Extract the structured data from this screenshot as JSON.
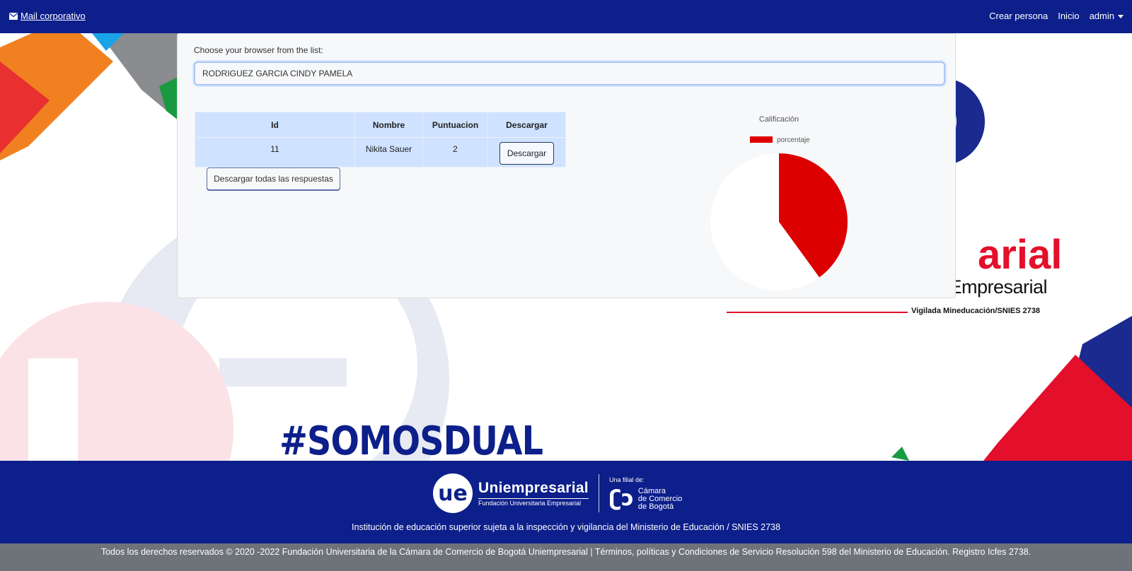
{
  "navbar": {
    "mail_label": "Mail corporativo",
    "crear_persona": "Crear persona",
    "inicio": "Inicio",
    "admin": "admin"
  },
  "form": {
    "label": "Choose your browser from the list:",
    "selected_value": "RODRIGUEZ GARCIA CINDY PAMELA"
  },
  "table": {
    "headers": [
      "Id",
      "Nombre",
      "Puntuacion",
      "Descargar"
    ],
    "rows": [
      {
        "id": "11",
        "nombre": "Nikita Sauer",
        "puntuacion": "2",
        "action": "Descargar"
      }
    ]
  },
  "download_all_label": "Descargar todas las respuestas",
  "chart_data": {
    "type": "pie",
    "title": "Calificación",
    "legend": [
      "porcentaje"
    ],
    "legend_position": "top",
    "slices": [
      {
        "label": "porcentaje",
        "value": 40,
        "color": "#dd0000"
      },
      {
        "label": "",
        "value": 60,
        "color": "#ffffff"
      }
    ]
  },
  "background": {
    "hashtag": "#SOMOSDUAL",
    "brand_partial": "arial",
    "brand_sub": "Fundación Universitaria Empresarial",
    "vigilada": "Vigilada Mineducación/SNIES 2738"
  },
  "footer": {
    "brand": "Uniempresarial",
    "brand_sub": "Fundación Universitaria Empresarial",
    "filial_label": "Una filial de:",
    "ccb_line1": "Cámara",
    "ccb_line2": "de Comercio",
    "ccb_line3": "de Bogotá",
    "institution_text": "Institución de educación superior sujeta a la inspección y vigilancia del Ministerio de Educación / SNIES 2738",
    "copyright": "Todos los derechos reservados © 2020 -2022 Fundación Universitaria de la Cámara de Comercio de Bogotá Uniempresarial | Términos, políticas y Condiciones de Servicio Resolución 598 del Ministerio de Educación. Registro Icfes 2738."
  },
  "colors": {
    "navy": "#0d1f8a",
    "red": "#e30f2b",
    "orange": "#f08020"
  }
}
